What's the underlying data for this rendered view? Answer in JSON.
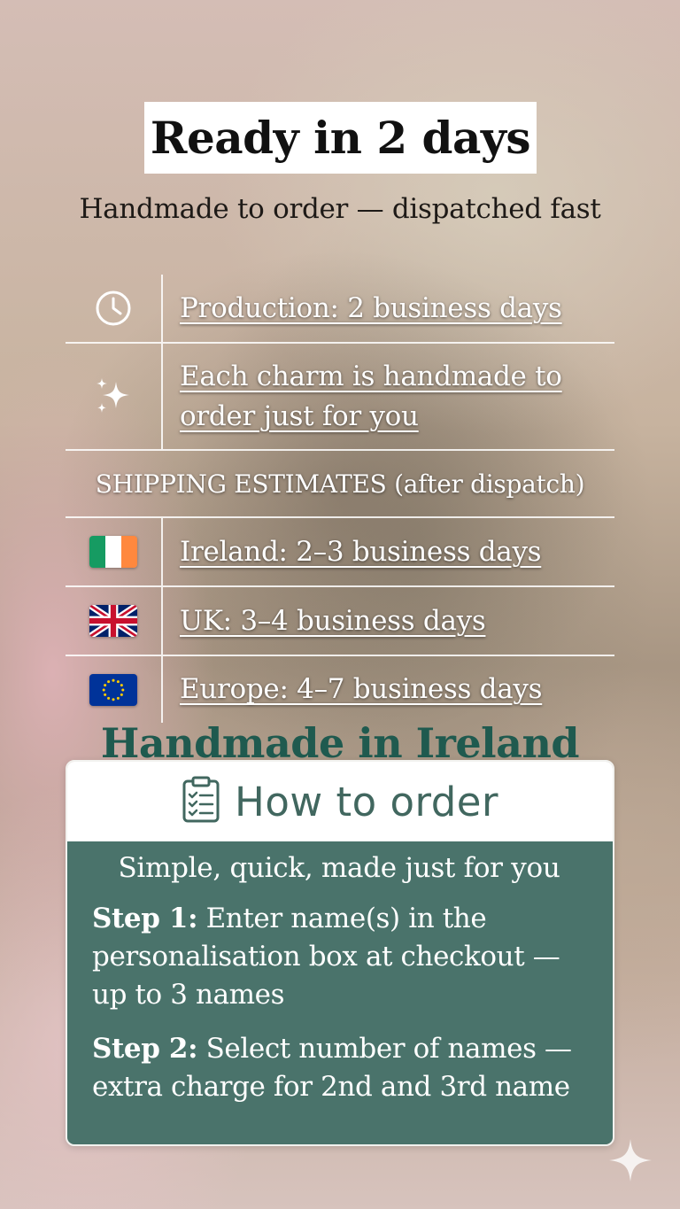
{
  "header": {
    "title": "Ready in 2 days",
    "subtitle": "Handmade to order — dispatched fast"
  },
  "info_rows": [
    {
      "icon": "clock-icon",
      "text": "Production: 2 business days"
    },
    {
      "icon": "sparkles-icon",
      "text": "Each charm is handmade to order just for you"
    }
  ],
  "shipping": {
    "heading": "SHIPPING ESTIMATES (after dispatch)",
    "rows": [
      {
        "icon": "ireland-flag-icon",
        "text": "Ireland: 2–3 business days"
      },
      {
        "icon": "uk-flag-icon",
        "text": "UK: 3–4 business days"
      },
      {
        "icon": "eu-flag-icon",
        "text": "Europe: 4–7 business days"
      }
    ]
  },
  "made_in": "Handmade in Ireland",
  "how_to_order": {
    "icon": "clipboard-checklist-icon",
    "title": "How to order",
    "tagline": "Simple, quick, made just for you",
    "steps": [
      {
        "label": "Step 1:",
        "text": " Enter name(s) in the personalisation box at checkout — up to 3 names"
      },
      {
        "label": "Step 2:",
        "text": " Select number of names — extra charge for 2nd and 3rd name"
      }
    ]
  },
  "colors": {
    "accent_green": "#1f5a4f",
    "card_teal": "#4a736b",
    "card_title": "#41675f"
  },
  "decor_icon": "sparkle-icon"
}
